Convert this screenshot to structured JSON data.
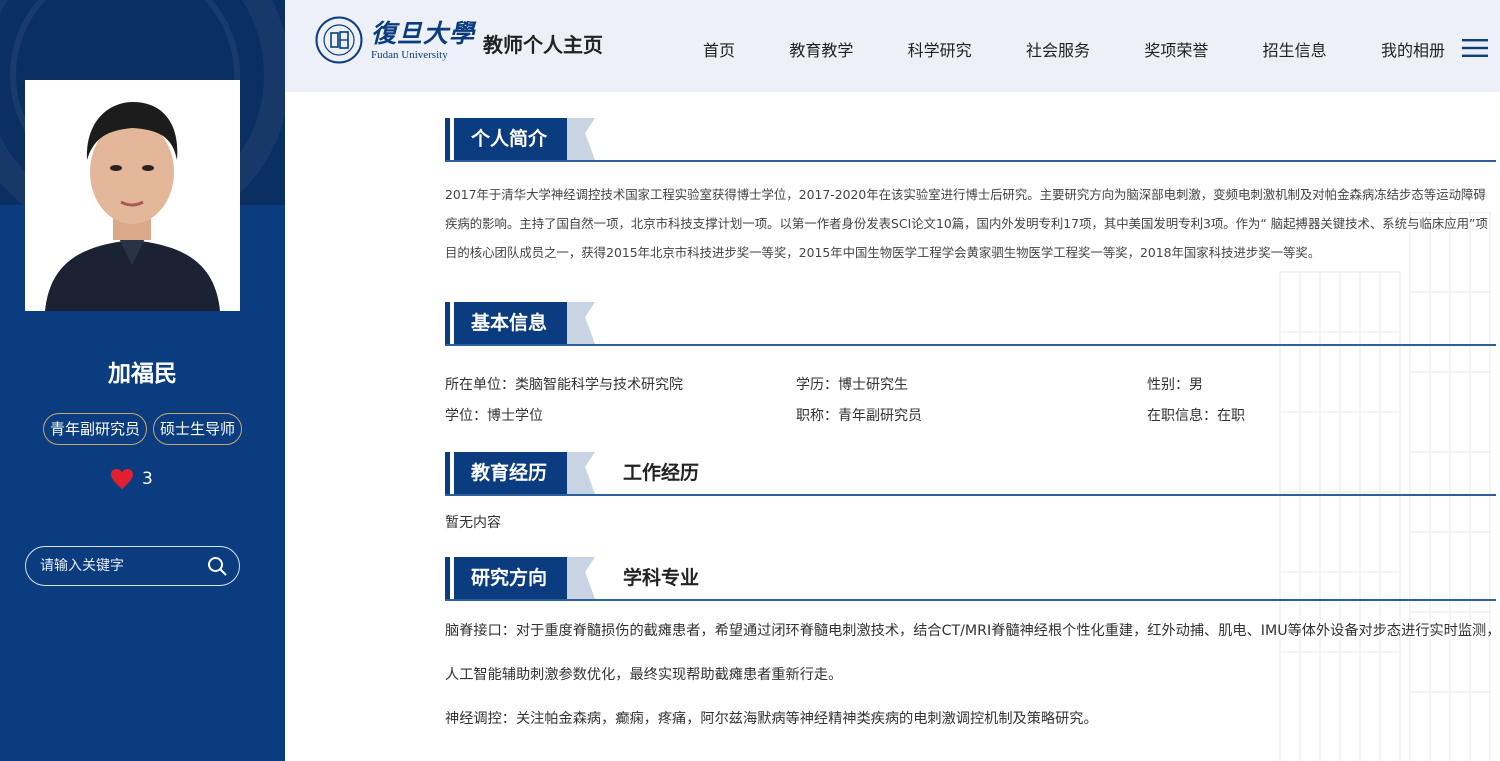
{
  "header": {
    "logo_cn": "復旦大學",
    "logo_en": "Fudan University",
    "site_title": "教师个人主页",
    "nav": [
      "首页",
      "教育教学",
      "科学研究",
      "社会服务",
      "奖项荣誉",
      "招生信息",
      "我的相册"
    ]
  },
  "profile": {
    "name": "加福民",
    "tags": [
      "青年副研究员",
      "硕士生导师"
    ],
    "likes": "3",
    "search_placeholder": "请输入关键字"
  },
  "sections": {
    "intro": {
      "title": "个人简介",
      "text": "2017年于清华大学神经调控技术国家工程实验室获得博士学位，2017-2020年在该实验室进行博士后研究。主要研究方向为脑深部电刺激，变频电刺激机制及对帕金森病冻结步态等运动障碍疾病的影响。主持了国自然一项，北京市科技支撑计划一项。以第一作者身份发表SCI论文10篇，国内外发明专利17项，其中美国发明专利3项。作为“ 脑起搏器关键技术、系统与临床应用”项目的核心团队成员之一，获得2015年北京市科技进步奖一等奖，2015年中国生物医学工程学会黄家驷生物医学工程奖一等奖，2018年国家科技进步奖一等奖。"
    },
    "basic": {
      "title": "基本信息",
      "rows": [
        [
          "所在单位：类脑智能科学与技术研究院",
          "学历：博士研究生",
          "性别：男"
        ],
        [
          "学位：博士学位",
          "职称：青年副研究员",
          "在职信息：在职"
        ]
      ]
    },
    "education": {
      "title": "教育经历",
      "alt_tab": "工作经历",
      "empty_text": "暂无内容"
    },
    "research": {
      "title": "研究方向",
      "alt_tab": "学科专业",
      "lines": [
        "脑脊接口：对于重度脊髓损伤的截瘫患者，希望通过闭环脊髓电刺激技术，结合CT/MRI脊髓神经根个性化重建，红外动捕、肌电、IMU等体外设备对步态进行实时监测，",
        "人工智能辅助刺激参数优化，最终实现帮助截瘫患者重新行走。",
        "神经调控：关注帕金森病，癫痫，疼痛，阿尔兹海默病等神经精神类疾病的电刺激调控机制及策略研究。"
      ]
    }
  },
  "colors": {
    "brand_blue": "#0b3c80",
    "sidebar_top": "#0a2f63",
    "header_bg": "#edf1f7",
    "heart_red": "#e02030",
    "tag_border": "#c9a86a"
  },
  "icons": [
    "fudan-seal-icon",
    "menu-icon",
    "heart-icon",
    "search-icon"
  ]
}
